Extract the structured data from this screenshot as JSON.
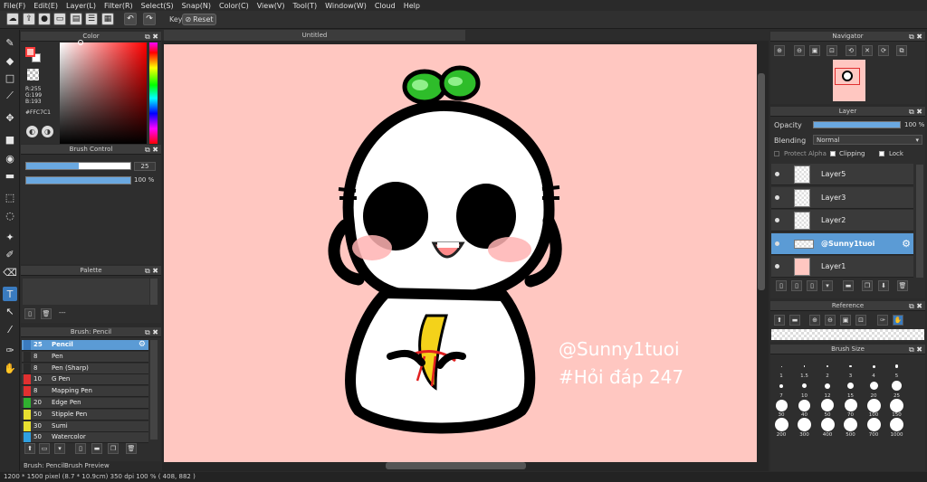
{
  "menu": [
    "File(F)",
    "Edit(E)",
    "Layer(L)",
    "Filter(R)",
    "Select(S)",
    "Snap(N)",
    "Color(C)",
    "View(V)",
    "Tool(T)",
    "Window(W)",
    "Cloud",
    "Help"
  ],
  "toolbar": {
    "key_label": "Key",
    "reset_label": "Reset"
  },
  "color_panel": {
    "title": "Color",
    "r": "R:255",
    "g": "G:199",
    "b": "B:193",
    "hex": "#FFC7C1",
    "fg_color": "#ffc7c1"
  },
  "brush_control": {
    "title": "Brush Control",
    "size_value": "25",
    "size_fraction": 0.5,
    "opacity_value": "100 %",
    "opacity_fraction": 1.0
  },
  "palette": {
    "title": "Palette",
    "dash": "---"
  },
  "brush_panel": {
    "title": "Brush: Pencil",
    "items": [
      {
        "size": "25",
        "name": "Pencil",
        "color": "#3a7bbf",
        "selected": true
      },
      {
        "size": "8",
        "name": "Pen",
        "color": "#2a2a2a"
      },
      {
        "size": "8",
        "name": "Pen (Sharp)",
        "color": "#2a2a2a"
      },
      {
        "size": "10",
        "name": "G Pen",
        "color": "#e03030"
      },
      {
        "size": "8",
        "name": "Mapping Pen",
        "color": "#e03030"
      },
      {
        "size": "20",
        "name": "Edge Pen",
        "color": "#30b030"
      },
      {
        "size": "50",
        "name": "Stipple Pen",
        "color": "#e8e030"
      },
      {
        "size": "30",
        "name": "Sumi",
        "color": "#e8e030"
      },
      {
        "size": "50",
        "name": "Watercolor",
        "color": "#30a0e0"
      }
    ]
  },
  "bottom_tabs": [
    "Brush: Pencil",
    "Brush Preview"
  ],
  "document": {
    "tab_title": "Untitled",
    "watermark_line1": "@Sunny1tuoi",
    "watermark_line2": "#Hỏi đáp 247"
  },
  "status": "1200 * 1500 pixel   (8.7 * 10.9cm)   350 dpi   100 %   ( 408, 882 )",
  "navigator": {
    "title": "Navigator"
  },
  "layers": {
    "title": "Layer",
    "opacity_label": "Opacity",
    "opacity_value": "100 %",
    "blending_label": "Blending",
    "blending_value": "Normal",
    "protect_alpha": "Protect Alpha",
    "clipping": "Clipping",
    "lock": "Lock",
    "items": [
      {
        "name": "Layer5"
      },
      {
        "name": "Layer3"
      },
      {
        "name": "Layer2"
      },
      {
        "name": "@Sunny1tuoi",
        "selected": true
      },
      {
        "name": "Layer1"
      }
    ]
  },
  "reference": {
    "title": "Reference"
  },
  "brush_size": {
    "title": "Brush Size",
    "sizes": [
      "1",
      "1.5",
      "2",
      "3",
      "4",
      "5",
      "7",
      "10",
      "12",
      "15",
      "20",
      "25",
      "30",
      "40",
      "50",
      "70",
      "100",
      "150",
      "200",
      "300",
      "400",
      "500",
      "700",
      "1000"
    ]
  }
}
